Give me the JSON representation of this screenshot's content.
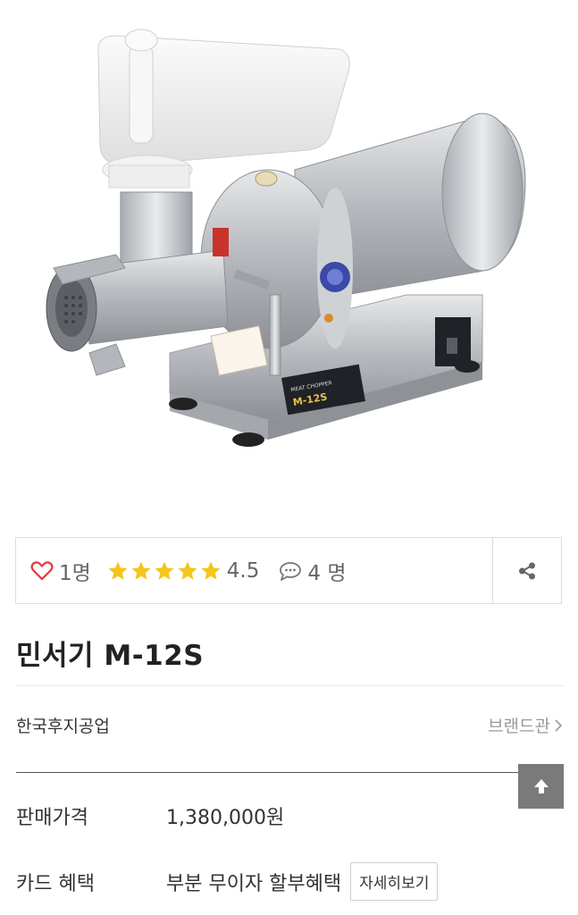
{
  "stats": {
    "like_count": "1명",
    "rating": "4.5",
    "star_count": 5,
    "comment_count": "4 명"
  },
  "product": {
    "title": "민서기 M-12S",
    "brand": "한국후지공업",
    "brand_link": "브랜드관",
    "price_label": "판매가격",
    "price_value": "1,380,000원",
    "card_label": "카드 혜택",
    "card_value": "부분 무이자 할부혜택",
    "detail_button": "자세히보기"
  },
  "machine_label": {
    "line1": "MEAT CHOPPER",
    "model": "M-12S"
  },
  "colors": {
    "heart": "#e6353e",
    "star": "#f5c518",
    "top_button": "#7a7a7a"
  },
  "icons": {
    "like": "heart-icon",
    "rating": "star-icon",
    "comment": "comment-icon",
    "share": "share-icon",
    "brand_arrow": "chevron-right-icon",
    "scroll_top": "arrow-up-icon"
  }
}
